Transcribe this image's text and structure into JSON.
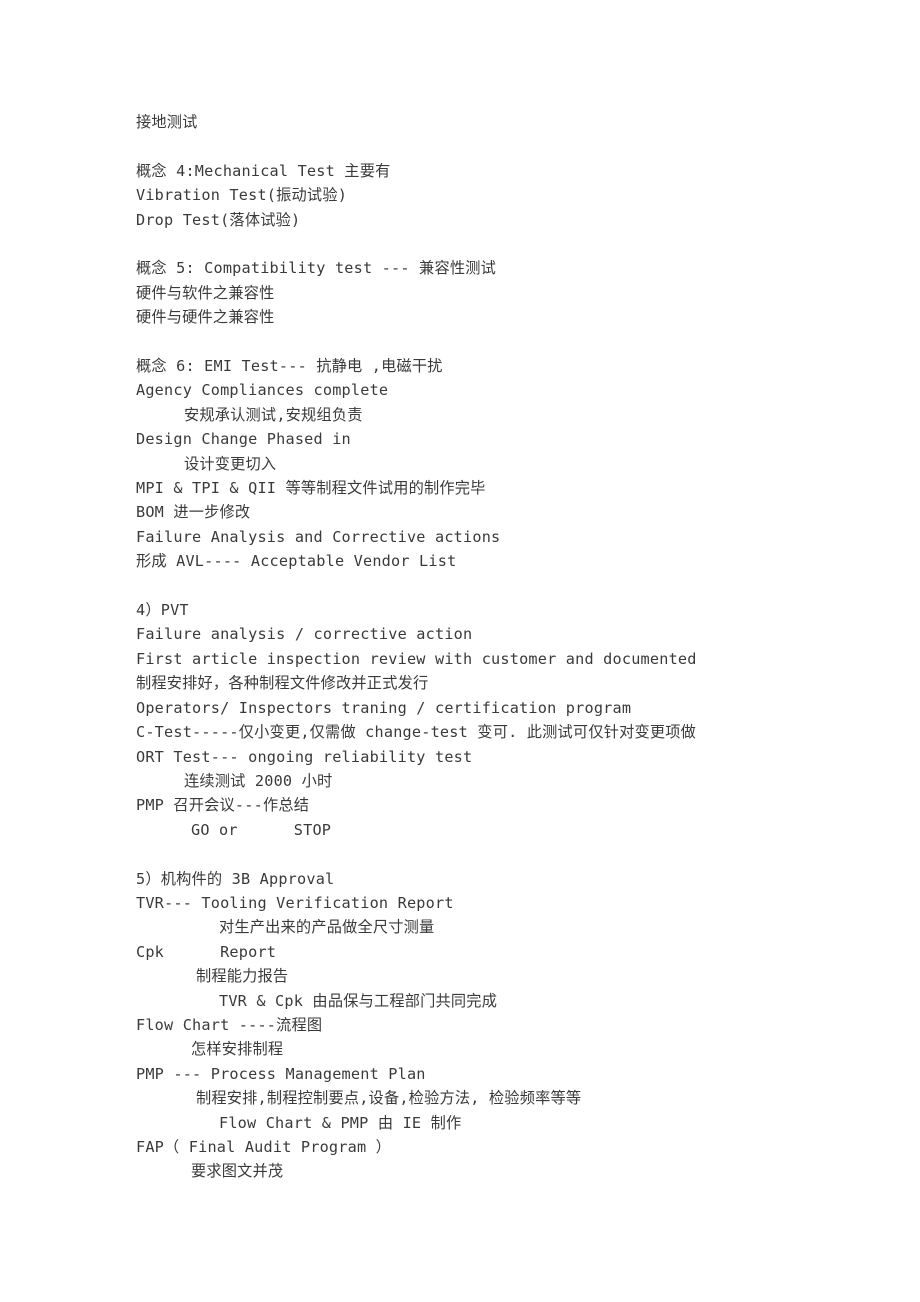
{
  "document": {
    "text_color": "#3a3a3a",
    "background_color": "#ffffff",
    "lines": [
      {
        "id": "l01",
        "text": "接地测试",
        "indent": 0
      },
      {
        "id": "l02",
        "text": "",
        "indent": 0
      },
      {
        "id": "l03",
        "text": "概念 4:Mechanical Test 主要有",
        "indent": 0
      },
      {
        "id": "l04",
        "text": "Vibration Test(振动试验)",
        "indent": 0
      },
      {
        "id": "l05",
        "text": "Drop Test(落体试验)",
        "indent": 0
      },
      {
        "id": "l06",
        "text": "",
        "indent": 0
      },
      {
        "id": "l07",
        "text": "概念 5: Compatibility test --- 兼容性测试",
        "indent": 0
      },
      {
        "id": "l08",
        "text": "硬件与软件之兼容性",
        "indent": 0
      },
      {
        "id": "l09",
        "text": "硬件与硬件之兼容性",
        "indent": 0
      },
      {
        "id": "l10",
        "text": "",
        "indent": 0
      },
      {
        "id": "l11",
        "text": "概念 6: EMI Test--- 抗静电 ,电磁干扰",
        "indent": 0
      },
      {
        "id": "l12",
        "text": "Agency Compliances complete",
        "indent": 0
      },
      {
        "id": "l13",
        "text": "安规承认测试,安规组负责",
        "indent": 8
      },
      {
        "id": "l14",
        "text": "Design Change Phased in",
        "indent": 0
      },
      {
        "id": "l15",
        "text": "设计变更切入",
        "indent": 8
      },
      {
        "id": "l16",
        "text": "MPI & TPI & QII 等等制程文件试用的制作完毕",
        "indent": 0
      },
      {
        "id": "l17",
        "text": "BOM 进一步修改",
        "indent": 0
      },
      {
        "id": "l18",
        "text": "Failure Analysis and Corrective actions",
        "indent": 0
      },
      {
        "id": "l19",
        "text": "形成 AVL---- Acceptable Vendor List",
        "indent": 0
      },
      {
        "id": "l20",
        "text": "",
        "indent": 0
      },
      {
        "id": "l21",
        "text": "4）PVT",
        "indent": 0
      },
      {
        "id": "l22",
        "text": "Failure analysis / corrective action",
        "indent": 0
      },
      {
        "id": "l23",
        "text": "First article inspection review with customer and documented",
        "indent": 0
      },
      {
        "id": "l24",
        "text": "制程安排好，各种制程文件修改并正式发行",
        "indent": 0
      },
      {
        "id": "l25",
        "text": "Operators/ Inspectors traning / certification program",
        "indent": 0
      },
      {
        "id": "l26",
        "text": "C-Test-----仅小变更,仅需做 change-test 变可. 此测试可仅针对变更项做",
        "indent": 0
      },
      {
        "id": "l27",
        "text": "ORT Test--- ongoing reliability test",
        "indent": 0
      },
      {
        "id": "l28",
        "text": "连续测试 2000 小时",
        "indent": 8
      },
      {
        "id": "l29",
        "text": "PMP 召开会议---作总结",
        "indent": 0
      },
      {
        "id": "l30",
        "text": "GO or      STOP",
        "indent": 6
      },
      {
        "id": "l31",
        "text": "",
        "indent": 0
      },
      {
        "id": "l32",
        "text": "5）机构件的 3B Approval",
        "indent": 0
      },
      {
        "id": "l33",
        "text": "TVR--- Tooling Verification Report",
        "indent": 0
      },
      {
        "id": "l34",
        "text": "对生产出来的产品做全尺寸测量",
        "indent": 12
      },
      {
        "id": "l35",
        "text": "Cpk      Report",
        "indent": 0
      },
      {
        "id": "l36",
        "text": "制程能力报告",
        "indent": 9
      },
      {
        "id": "l37",
        "text": "TVR & Cpk 由品保与工程部门共同完成",
        "indent": 12
      },
      {
        "id": "l38",
        "text": "Flow Chart ----流程图",
        "indent": 0
      },
      {
        "id": "l39",
        "text": "怎样安排制程",
        "indent": 6
      },
      {
        "id": "l40",
        "text": "PMP --- Process Management Plan",
        "indent": 0
      },
      {
        "id": "l41",
        "text": "制程安排,制程控制要点,设备,检验方法, 检验频率等等",
        "indent": 9
      },
      {
        "id": "l42",
        "text": "Flow Chart & PMP 由 IE 制作",
        "indent": 12
      },
      {
        "id": "l43",
        "text": "FAP（ Final Audit Program ）",
        "indent": 0
      },
      {
        "id": "l44",
        "text": "要求图文并茂",
        "indent": 6
      }
    ]
  }
}
